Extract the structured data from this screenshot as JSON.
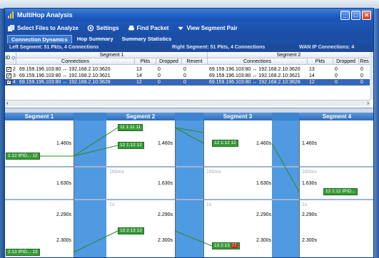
{
  "window": {
    "title": "MultiHop Analysis",
    "min": "_",
    "max": "□",
    "close": "×"
  },
  "toolbar": {
    "select": "Select Files to Analyze",
    "settings": "Settings",
    "find": "Find Packet",
    "view": "View Segment Pair"
  },
  "tabs": [
    "Connection Dynamics",
    "Hop Summary",
    "Summary Statistics"
  ],
  "info": {
    "left": "Left Segment:  51 Pkts,   4 Connections",
    "right": "Right Segment:  51 Pkts,   4 Connections",
    "wan": "WAN IP Connections: 4"
  },
  "table": {
    "id_header": "ID",
    "seg1": "Segment 1",
    "seg2": "Segment 2",
    "cols": {
      "conn": "Connections",
      "pkts": "Pkts",
      "dropped": "Dropped",
      "resent": "Resent",
      "resent2": "Res"
    },
    "rows": [
      {
        "id": "2",
        "conn1": "69.159.196.103:80 ↔ 192.168.2.10:3620",
        "p1": "13",
        "d1": "0",
        "r1": "0",
        "conn2": "69.159.196.103:80 ↔ 192.168.2.10:3620",
        "p2": "13",
        "d2": "0",
        "r2": "0"
      },
      {
        "id": "3",
        "conn1": "69.159.196.103:80 ↔ 192.168.2.10:3621",
        "p1": "14",
        "d1": "0",
        "r1": "0",
        "conn2": "69.159.196.103:80 ↔ 192.168.2.10:3621",
        "p2": "14",
        "d2": "0",
        "r2": "0"
      },
      {
        "id": "4",
        "conn1": "69.159.196.103:80 ↔ 192.168.2.10:3628",
        "p1": "12",
        "d1": "0",
        "r1": "0",
        "conn2": "69.159.196.103:80 ↔ 192.168.2.10:3628",
        "p2": "12",
        "d2": "0",
        "r2": "0"
      }
    ]
  },
  "diagram": {
    "segments": [
      "Segment 1",
      "Segment 2",
      "Segment 3",
      "Segment 4"
    ],
    "ticks": {
      "t1": "1.460s",
      "t2": "1.630s",
      "t3": "2.290s",
      "t4": "2.300s"
    },
    "gaps": {
      "g1": "160ms",
      "g2": "1s"
    },
    "packets": {
      "p1": "1:12 IPID... 12",
      "p2": "11 1:11 11",
      "p3": "12 1:12 12",
      "p4": "12 1:12 12",
      "p5": "12 1:12 IPID...",
      "p6": "13 2:13 13",
      "p7": "13 2:13",
      "p7r": "77",
      "p8": "2:13 IPID... 13"
    }
  }
}
